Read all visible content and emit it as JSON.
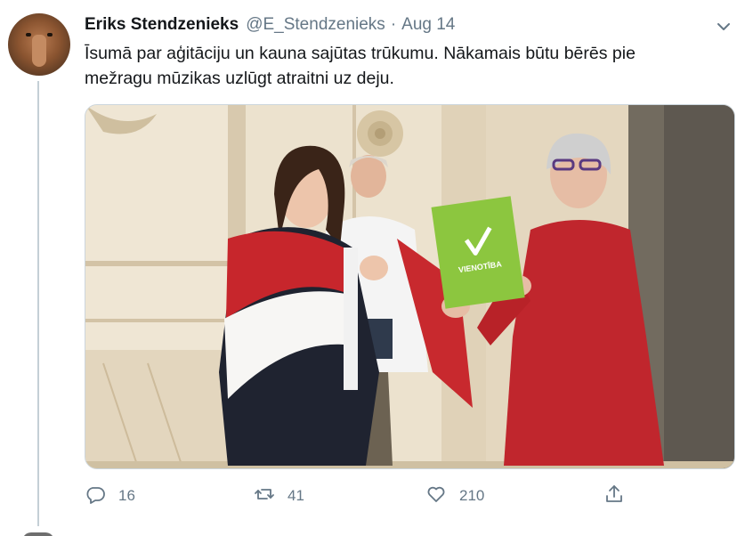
{
  "tweet": {
    "author_name": "Eriks Stendzenieks",
    "handle": "@E_Stendzenieks",
    "separator": "·",
    "date": "Aug 14",
    "text_line1": "Īsumā par aģitāciju un kauna sajūtas trūkumu. Nākamais būtu bērēs pie",
    "text_line2": "mežragu mūzikas uzlūgt atraitni uz deju.",
    "media": {
      "folder_text": "VIENOTĪBA",
      "folder_color": "#8cc63f",
      "description_icon": "photo"
    },
    "actions": {
      "reply_icon": "reply-icon",
      "reply_count": "16",
      "retweet_icon": "retweet-icon",
      "retweet_count": "41",
      "like_icon": "heart-icon",
      "like_count": "210",
      "share_icon": "share-icon"
    },
    "colors": {
      "secondary_text": "#657786",
      "thread_line": "#c4cfd6",
      "dress_red": "#c0262d"
    }
  }
}
